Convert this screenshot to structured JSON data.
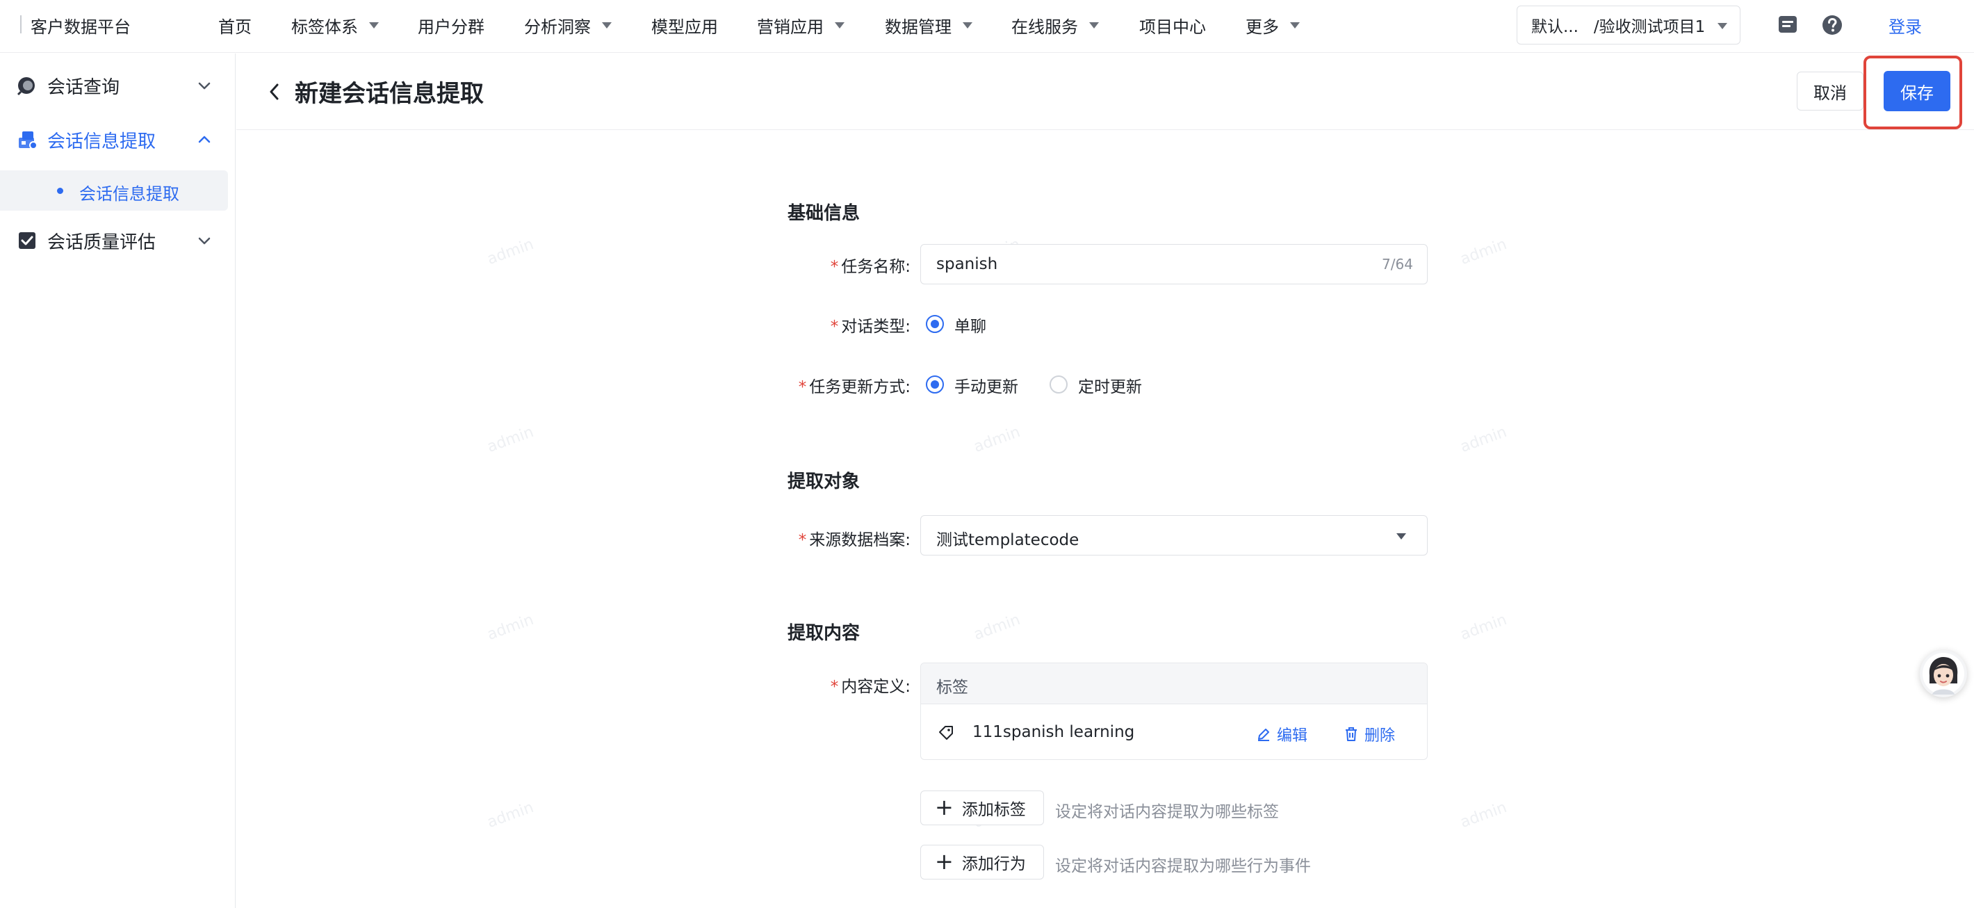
{
  "topbar": {
    "brand": "客户数据平台",
    "nav": [
      {
        "label": "首页",
        "has_dropdown": false
      },
      {
        "label": "标签体系",
        "has_dropdown": true
      },
      {
        "label": "用户分群",
        "has_dropdown": false
      },
      {
        "label": "分析洞察",
        "has_dropdown": true
      },
      {
        "label": "模型应用",
        "has_dropdown": false
      },
      {
        "label": "营销应用",
        "has_dropdown": true
      },
      {
        "label": "数据管理",
        "has_dropdown": true
      },
      {
        "label": "在线服务",
        "has_dropdown": true
      },
      {
        "label": "项目中心",
        "has_dropdown": false
      },
      {
        "label": "更多",
        "has_dropdown": true
      }
    ],
    "project_select": "默认...   /验收测试项目1",
    "icons": [
      "message-icon",
      "help-icon"
    ],
    "login_label": "登录"
  },
  "sidebar": {
    "items": [
      {
        "label": "会话查询",
        "icon": "chat-search-icon",
        "expanded": false,
        "active": false
      },
      {
        "label": "会话信息提取",
        "icon": "extract-icon",
        "expanded": true,
        "active": true,
        "children": [
          {
            "label": "会话信息提取",
            "active": true
          }
        ]
      },
      {
        "label": "会话质量评估",
        "icon": "checkbox-icon",
        "expanded": false,
        "active": false
      }
    ]
  },
  "header": {
    "title": "新建会话信息提取",
    "cancel_label": "取消",
    "save_label": "保存"
  },
  "form": {
    "basic": {
      "title": "基础信息",
      "task_name_label": "任务名称:",
      "task_name_value": "spanish",
      "task_name_count": "7/64",
      "dialog_type_label": "对话类型:",
      "dialog_type_options": [
        {
          "label": "单聊",
          "checked": true
        }
      ],
      "update_mode_label": "任务更新方式:",
      "update_mode_options": [
        {
          "label": "手动更新",
          "checked": true
        },
        {
          "label": "定时更新",
          "checked": false
        }
      ]
    },
    "target": {
      "title": "提取对象",
      "source_label": "来源数据档案:",
      "source_value": "测试templatecode"
    },
    "content": {
      "title": "提取内容",
      "definition_label": "内容定义:",
      "table_header": "标签",
      "rows": [
        {
          "name": "111spanish learning",
          "edit": "编辑",
          "delete": "删除"
        }
      ],
      "add_tag_label": "添加标签",
      "add_tag_hint": "设定将对话内容提取为哪些标签",
      "add_action_label": "添加行为",
      "add_action_hint": "设定将对话内容提取为哪些行为事件"
    }
  },
  "watermark_text": "admin",
  "colors": {
    "primary": "#2d6bf0",
    "required": "#e0443a",
    "highlight_outline": "#e0443a",
    "hint_text": "#8a8f99"
  }
}
